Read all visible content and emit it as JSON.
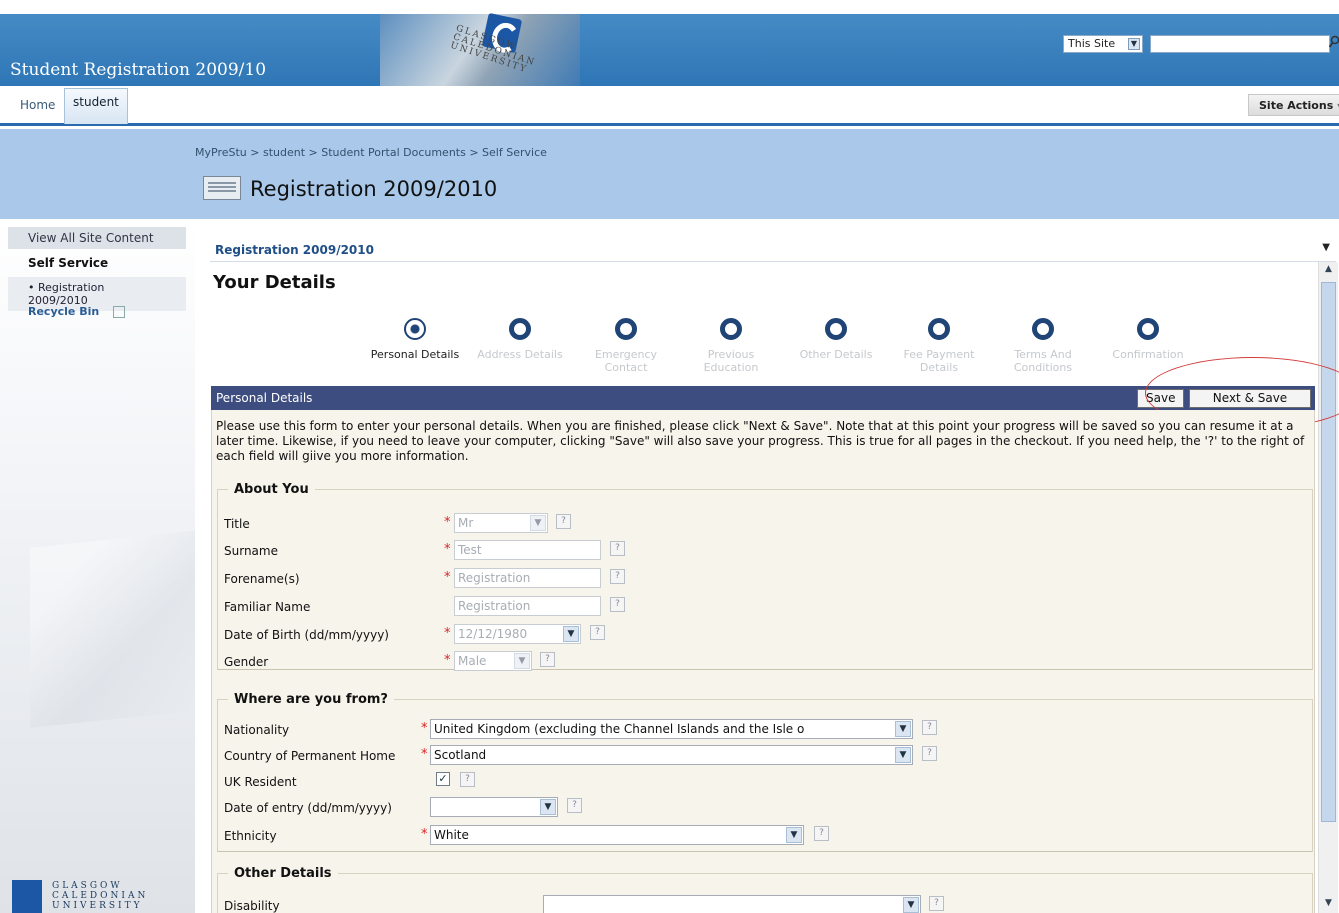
{
  "header": {
    "site_title": "Student Registration 2009/10",
    "logo_text": "GLASGOW CALEDONIAN UNIVERSITY",
    "scope": "This Site",
    "search_value": ""
  },
  "nav": {
    "tabs": [
      {
        "label": "Home"
      },
      {
        "label": "student"
      }
    ],
    "site_actions": "Site Actions"
  },
  "title_area": {
    "breadcrumb": "MyPreStu > student > Student Portal Documents > Self Service",
    "title": "Registration 2009/2010"
  },
  "leftnav": {
    "view_all": "View All Site Content",
    "section": "Self Service",
    "item": "Registration 2009/2010",
    "recycle": "Recycle Bin",
    "footer_logo": "GLASGOW CALEDONIAN UNIVERSITY"
  },
  "webpart": {
    "title": "Registration 2009/2010",
    "heading": "Your Details"
  },
  "steps": [
    {
      "label": "Personal Details"
    },
    {
      "label": "Address Details"
    },
    {
      "label": "Emergency Contact"
    },
    {
      "label": "Previous Education"
    },
    {
      "label": "Other Details"
    },
    {
      "label": "Fee Payment Details"
    },
    {
      "label": "Terms And Conditions"
    },
    {
      "label": "Confirmation"
    }
  ],
  "panel": {
    "title": "Personal Details",
    "save": "Save",
    "next_save": "Next & Save",
    "instructions": "Please use this form to enter your personal details. When you are finished, please click \"Next & Save\". Note that at this point your progress will be saved so you can resume it at a later time. Likewise, if you need to leave your computer, clicking \"Save\" will also save your progress. This is true for all pages in the checkout. If you need help, the '?' to the right of each field will giive you more information."
  },
  "about_you": {
    "legend": "About You",
    "title_label": "Title",
    "title_value": "Mr",
    "surname_label": "Surname",
    "surname_value": "Test",
    "forename_label": "Forename(s)",
    "forename_value": "Registration",
    "familiar_label": "Familiar Name",
    "familiar_value": "Registration",
    "dob_label": "Date of Birth (dd/mm/yyyy)",
    "dob_value": "12/12/1980",
    "gender_label": "Gender",
    "gender_value": "Male"
  },
  "where_from": {
    "legend": "Where are you from?",
    "nationality_label": "Nationality",
    "nationality_value": "United Kingdom (excluding the Channel Islands and the Isle o",
    "country_label": "Country of Permanent Home",
    "country_value": "Scotland",
    "uk_resident_label": "UK Resident",
    "uk_resident_checked": true,
    "entry_label": "Date of entry (dd/mm/yyyy)",
    "entry_value": "",
    "ethnicity_label": "Ethnicity",
    "ethnicity_value": "White"
  },
  "other_details": {
    "legend": "Other Details",
    "disability_label": "Disability",
    "disability_value": ""
  },
  "symbols": {
    "required": "*",
    "help": "?",
    "dropdown": "▼",
    "check": "✓"
  }
}
